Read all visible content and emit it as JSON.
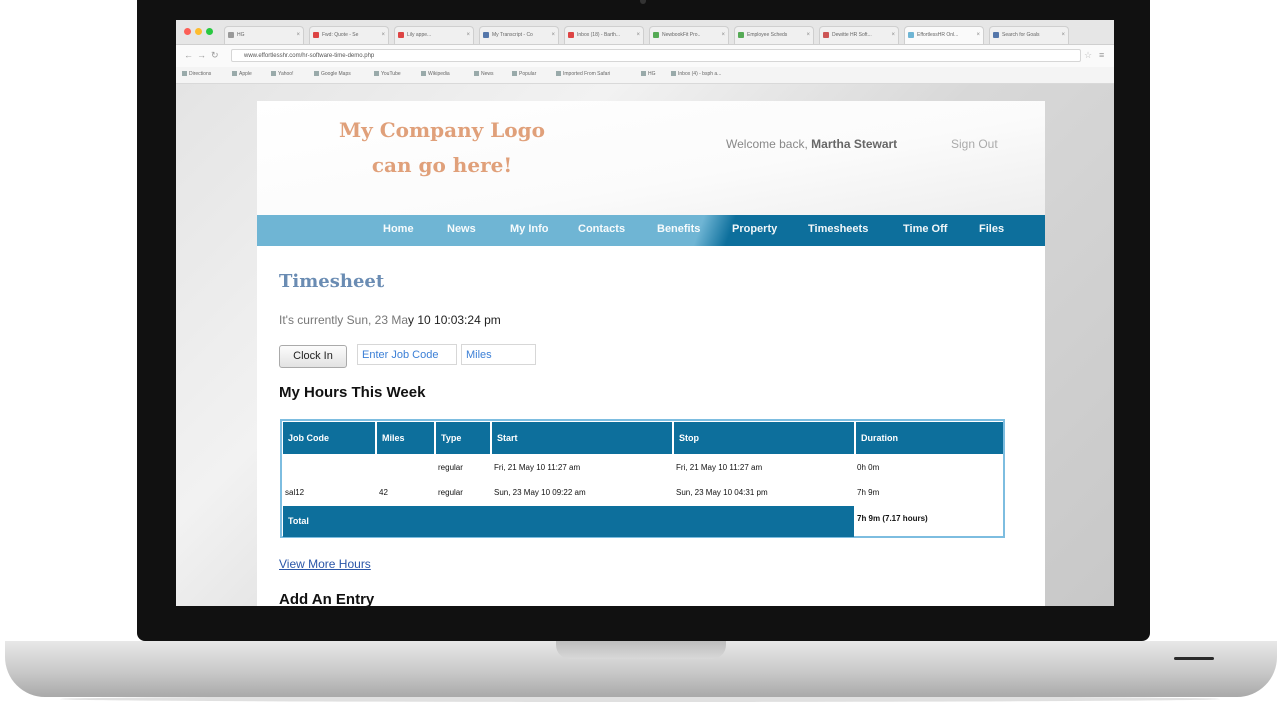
{
  "browser": {
    "tabs": [
      {
        "label": "HG"
      },
      {
        "label": "Fwd: Quote - Se"
      },
      {
        "label": "Lily appe..."
      },
      {
        "label": "My Transcript - Co"
      },
      {
        "label": "Inbox (18) - Barth..."
      },
      {
        "label": "NewbookFit Pro.."
      },
      {
        "label": "Employee Scheds"
      },
      {
        "label": "Dewitte HR Soft..."
      },
      {
        "label": "EffortlessHR Onl..."
      },
      {
        "label": "Search for Goals"
      }
    ],
    "url": "www.effortlesshr.com/hr-software-time-demo.php",
    "bookmarks": [
      "Directions",
      "Apple",
      "Yahoo!",
      "Google Maps",
      "YouTube",
      "Wikipedia",
      "News",
      "Popular",
      "Imported From Safari",
      "HG",
      "Inbox (4) - bsph a..."
    ]
  },
  "site": {
    "logo_line1": "My Company Logo",
    "logo_line2": "can go here!",
    "welcome_prefix": "Welcome back,",
    "user_name": "Martha Stewart",
    "sign_out": "Sign Out",
    "nav": [
      "Home",
      "News",
      "My Info",
      "Contacts",
      "Benefits",
      "Property",
      "Timesheets",
      "Time Off",
      "Files"
    ]
  },
  "timesheet": {
    "title": "Timesheet",
    "clock_prefix": "It's currently Sun, 23 Ma",
    "clock_time": "y 10 10:03:24 pm",
    "clock_in_label": "Clock In",
    "job_code_placeholder": "Enter Job Code",
    "miles_placeholder": "Miles",
    "hours_heading": "My Hours This Week",
    "columns": [
      "Job Code",
      "Miles",
      "Type",
      "Start",
      "Stop",
      "Duration"
    ],
    "rows": [
      [
        "",
        "",
        "regular",
        "Fri, 21 May 10 11:27 am",
        "Fri, 21 May 10 11:27 am",
        "0h 0m"
      ],
      [
        "sal12",
        "42",
        "regular",
        "Sun, 23 May 10 09:22 am",
        "Sun, 23 May 10 04:31 pm",
        "7h 9m"
      ]
    ],
    "total_label": "Total",
    "total_value": "7h 9m (7.17 hours)",
    "view_more": "View More Hours",
    "add_entry": "Add An Entry"
  },
  "colors": {
    "nav_light": "#6fb5d4",
    "nav_dark": "#0d6f9c",
    "logo": "#e0a07a",
    "title": "#6a8cb3"
  }
}
